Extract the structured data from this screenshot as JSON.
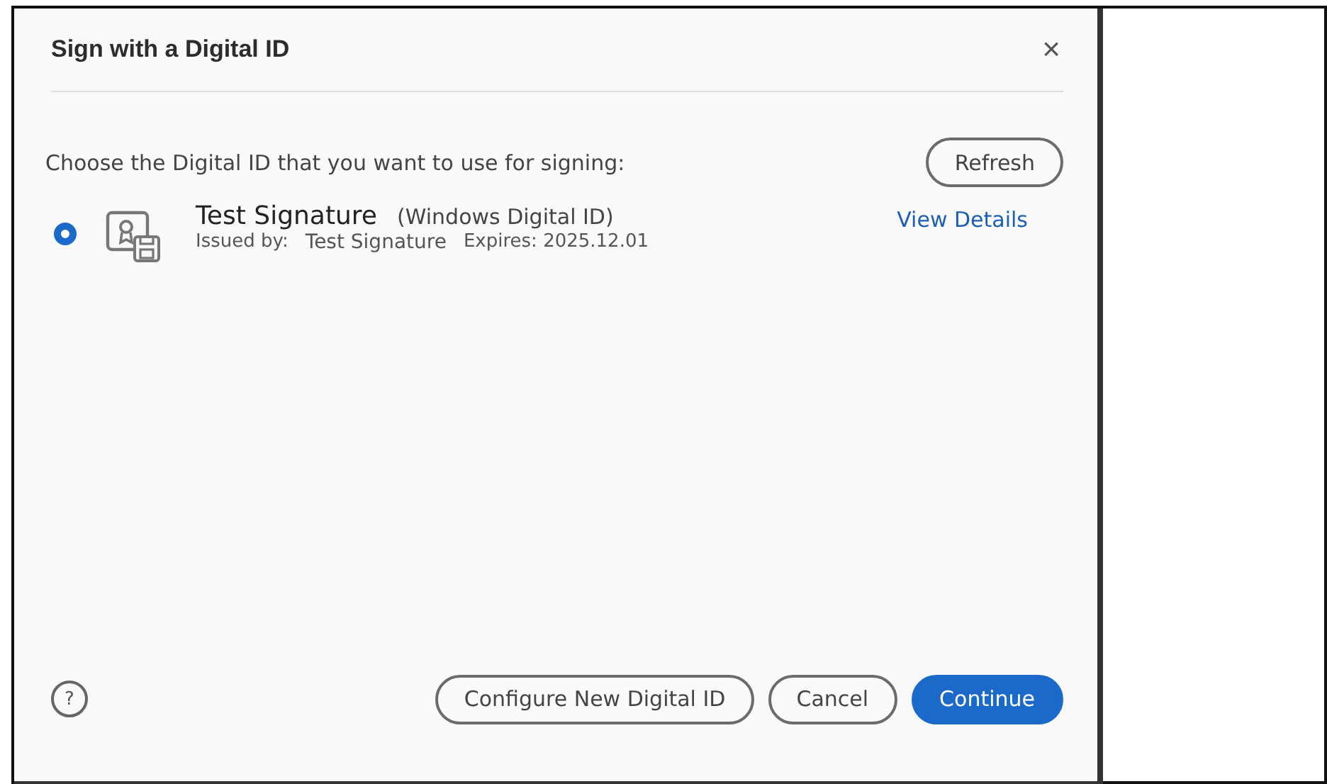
{
  "dialog": {
    "title": "Sign with a Digital ID",
    "close": "×",
    "prompt": "Choose the Digital ID that you want to use for signing:",
    "refresh": "Refresh"
  },
  "ids": [
    {
      "name": "Test Signature",
      "type": "(Windows Digital ID)",
      "issued_label": "Issued by:",
      "issuer": "Test Signature",
      "expires": "Expires: 2025.12.01",
      "details_link": "View Details",
      "selected": true
    }
  ],
  "footer": {
    "help": "?",
    "buttons": [
      {
        "label": "Configure New Digital ID",
        "kind": "secondary"
      },
      {
        "label": "Cancel",
        "kind": "secondary"
      },
      {
        "label": "Continue",
        "kind": "primary"
      }
    ]
  }
}
